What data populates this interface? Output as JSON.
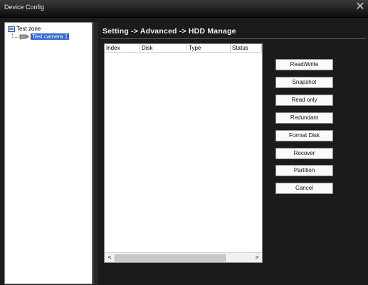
{
  "window": {
    "title": "Device Config",
    "close_label": "✕"
  },
  "tree": {
    "root": {
      "label": "Test zone",
      "icon": "zone-icon"
    },
    "child": {
      "label": "Test camera 1",
      "icon": "camera-icon"
    }
  },
  "main": {
    "breadcrumb": "Setting -> Advanced -> HDD Manage",
    "table": {
      "columns": [
        "Index",
        "Disk",
        "Type",
        "Status"
      ],
      "rows": []
    },
    "scroll": {
      "left": "<",
      "right": ">"
    },
    "buttons": {
      "read_write": "Read/Write",
      "snapshot": "Snapshot",
      "read_only": "Read only",
      "redundant": "Redundant",
      "format_disk": "Format Disk",
      "recover": "Recover",
      "partition": "Partition",
      "cancel": "Cancel"
    }
  },
  "colors": {
    "selection": "#3366cc",
    "background": "#1b1b1b"
  }
}
